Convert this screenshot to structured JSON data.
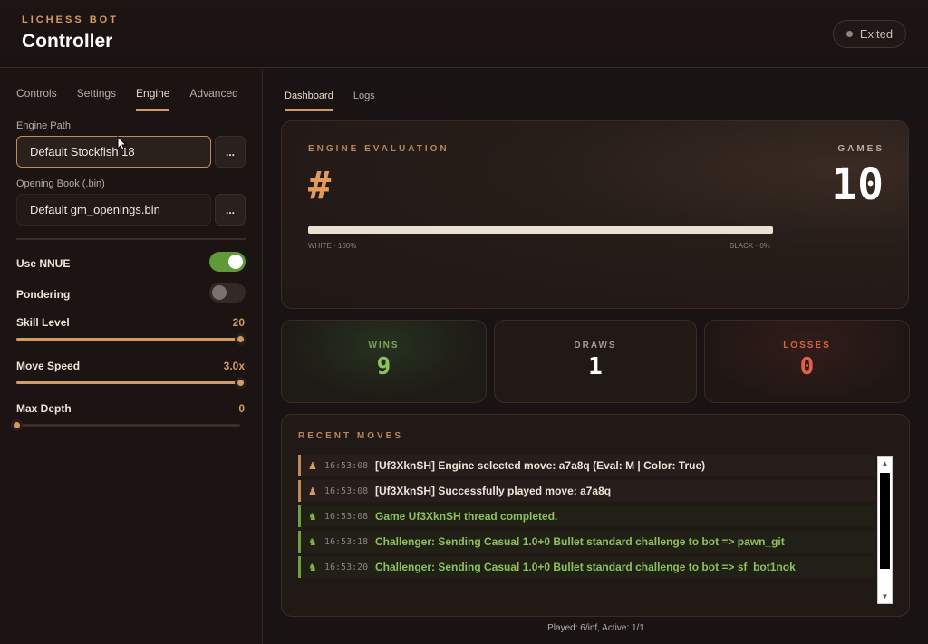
{
  "header": {
    "brand": "LICHESS BOT",
    "title": "Controller",
    "status": "Exited"
  },
  "sidebar": {
    "tabs": [
      "Controls",
      "Settings",
      "Engine",
      "Advanced"
    ],
    "active_tab": "Engine",
    "engine_path": {
      "label": "Engine Path",
      "value": "Default Stockfish 18",
      "browse_label": "..."
    },
    "opening_book": {
      "label": "Opening Book (.bin)",
      "value": "Default gm_openings.bin",
      "browse_label": "..."
    },
    "use_nnue": {
      "label": "Use NNUE",
      "enabled": true
    },
    "pondering": {
      "label": "Pondering",
      "enabled": false
    },
    "skill_level": {
      "label": "Skill Level",
      "value": "20",
      "fraction": 1.0
    },
    "move_speed": {
      "label": "Move Speed",
      "value": "3.0x",
      "fraction": 1.0
    },
    "max_depth": {
      "label": "Max Depth",
      "value": "0",
      "fraction": 0.0
    }
  },
  "main": {
    "tabs": [
      "Dashboard",
      "Logs"
    ],
    "active_tab": "Dashboard",
    "evaluation": {
      "label": "ENGINE EVALUATION",
      "value": "#",
      "white_label": "WHITE · 100%",
      "black_label": "BLACK · 0%",
      "white_fraction": 1.0
    },
    "games": {
      "label": "GAMES",
      "value": "10"
    },
    "stats": {
      "wins": {
        "label": "WINS",
        "value": "9"
      },
      "draws": {
        "label": "DRAWS",
        "value": "1"
      },
      "losses": {
        "label": "LOSSES",
        "value": "0"
      }
    },
    "recent_moves": {
      "title": "RECENT MOVES",
      "entries": [
        {
          "time": "16:53:08",
          "message": "[Uf3XknSH] Engine selected move: a7a8q (Eval: M | Color: True)",
          "kind": "orange"
        },
        {
          "time": "16:53:08",
          "message": "[Uf3XknSH] Successfully played move: a7a8q",
          "kind": "orange"
        },
        {
          "time": "16:53:08",
          "message": "Game Uf3XknSH thread completed.",
          "kind": "green"
        },
        {
          "time": "16:53:18",
          "message": "Challenger: Sending Casual 1.0+0 Bullet standard challenge to bot => pawn_git",
          "kind": "green"
        },
        {
          "time": "16:53:20",
          "message": "Challenger: Sending Casual 1.0+0 Bullet standard challenge to bot => sf_bot1nok",
          "kind": "green"
        }
      ]
    },
    "footer": "Played: 6/inf, Active: 1/1"
  },
  "colors": {
    "accent": "#d39a62",
    "win": "#7fb34a",
    "loss": "#e0604c",
    "background": "#1a1313"
  }
}
